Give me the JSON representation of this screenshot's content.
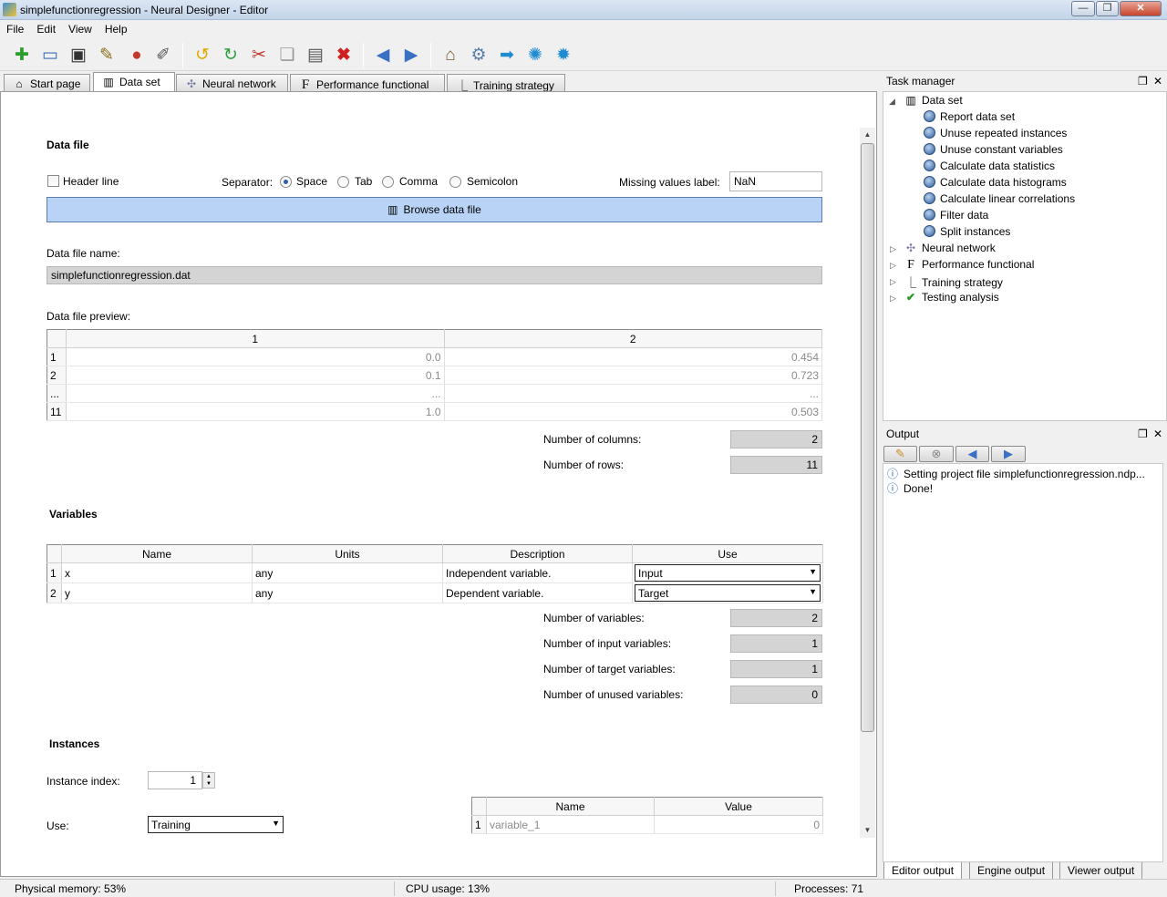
{
  "window": {
    "title": "simplefunctionregression - Neural Designer - Editor"
  },
  "menu": [
    "File",
    "Edit",
    "View",
    "Help"
  ],
  "toolbar_icons": [
    "new-project-icon",
    "open-icon",
    "save-icon",
    "save-as-icon",
    "close-project-icon",
    "edit-icon",
    "undo-icon",
    "redo-icon",
    "cut-icon",
    "copy-icon",
    "paste-icon",
    "delete-icon",
    "back-icon",
    "forward-icon",
    "home-icon",
    "settings-icon",
    "run-icon",
    "report-icon",
    "help-icon"
  ],
  "tabs": [
    {
      "label": "Start page",
      "icon": "home-icon"
    },
    {
      "label": "Data set",
      "icon": "database-icon"
    },
    {
      "label": "Neural network",
      "icon": "network-icon"
    },
    {
      "label": "Performance functional",
      "icon": "function-icon"
    },
    {
      "label": "Training strategy",
      "icon": "chart-icon"
    }
  ],
  "datafile": {
    "section": "Data file",
    "header_line": "Header line",
    "separator_label": "Separator:",
    "separators": [
      "Space",
      "Tab",
      "Comma",
      "Semicolon"
    ],
    "missing_label": "Missing values label:",
    "missing_value": "NaN",
    "browse": "Browse data file",
    "name_label": "Data file name:",
    "name_value": "simplefunctionregression.dat",
    "preview_label": "Data file preview:",
    "preview_headers": [
      "1",
      "2"
    ],
    "preview_rows": [
      [
        "1",
        "0.0",
        "0.454"
      ],
      [
        "2",
        "0.1",
        "0.723"
      ],
      [
        "...",
        "...",
        "..."
      ],
      [
        "11",
        "1.0",
        "0.503"
      ]
    ],
    "cols_label": "Number of columns:",
    "cols_value": "2",
    "rows_label": "Number of rows:",
    "rows_value": "11"
  },
  "variables": {
    "section": "Variables",
    "headers": [
      "Name",
      "Units",
      "Description",
      "Use"
    ],
    "rows": [
      {
        "idx": "1",
        "name": "x",
        "units": "any",
        "desc": "Independent variable.",
        "use": "Input"
      },
      {
        "idx": "2",
        "name": "y",
        "units": "any",
        "desc": "Dependent variable.",
        "use": "Target"
      }
    ],
    "stats": [
      {
        "label": "Number of variables:",
        "value": "2"
      },
      {
        "label": "Number of input variables:",
        "value": "1"
      },
      {
        "label": "Number of target variables:",
        "value": "1"
      },
      {
        "label": "Number of unused variables:",
        "value": "0"
      }
    ]
  },
  "instances": {
    "section": "Instances",
    "index_label": "Instance index:",
    "index_value": "1",
    "use_label": "Use:",
    "use_value": "Training",
    "headers": [
      "Name",
      "Value"
    ],
    "rows": [
      [
        "1",
        "variable_1",
        "0"
      ]
    ]
  },
  "task_manager": {
    "title": "Task manager",
    "root": "Data set",
    "tasks": [
      "Report data set",
      "Unuse repeated instances",
      "Unuse constant variables",
      "Calculate data statistics",
      "Calculate data histograms",
      "Calculate linear correlations",
      "Filter data",
      "Split instances"
    ],
    "others": [
      "Neural network",
      "Performance functional",
      "Training strategy",
      "Testing analysis"
    ]
  },
  "output": {
    "title": "Output",
    "messages": [
      "Setting project file simplefunctionregression.ndp...",
      "Done!"
    ],
    "tabs": [
      "Editor output",
      "Engine output",
      "Viewer output"
    ]
  },
  "status": {
    "memory": "Physical memory: 53%",
    "cpu": "CPU usage: 13%",
    "processes": "Processes: 71"
  }
}
